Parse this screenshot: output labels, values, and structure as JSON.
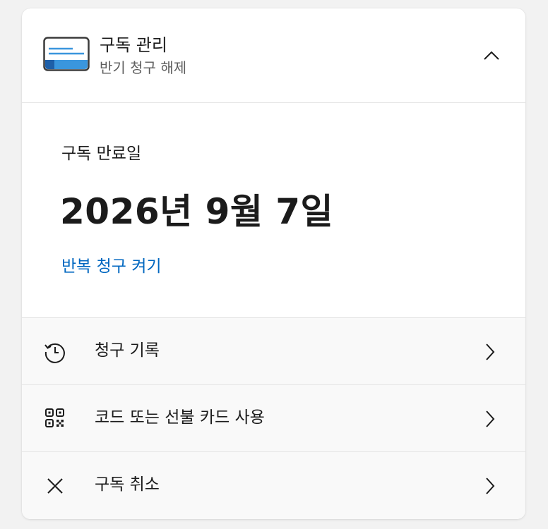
{
  "header": {
    "title": "구독 관리",
    "subtitle": "반기 청구 해제",
    "icon": "subscription-card-icon",
    "collapse_icon": "chevron-up-icon"
  },
  "subscription": {
    "expiry_label": "구독 만료일",
    "expiry_date": "2026년 9월 7일",
    "recurring_link": "반복 청구 켜기"
  },
  "options": [
    {
      "label": "청구 기록",
      "icon": "history-icon"
    },
    {
      "label": "코드 또는 선불 카드 사용",
      "icon": "qr-code-icon"
    },
    {
      "label": "구독 취소",
      "icon": "close-icon"
    }
  ],
  "colors": {
    "link": "#0067c0",
    "card_accent": "#3a96dd",
    "card_accent_dark": "#1e6fbf"
  }
}
